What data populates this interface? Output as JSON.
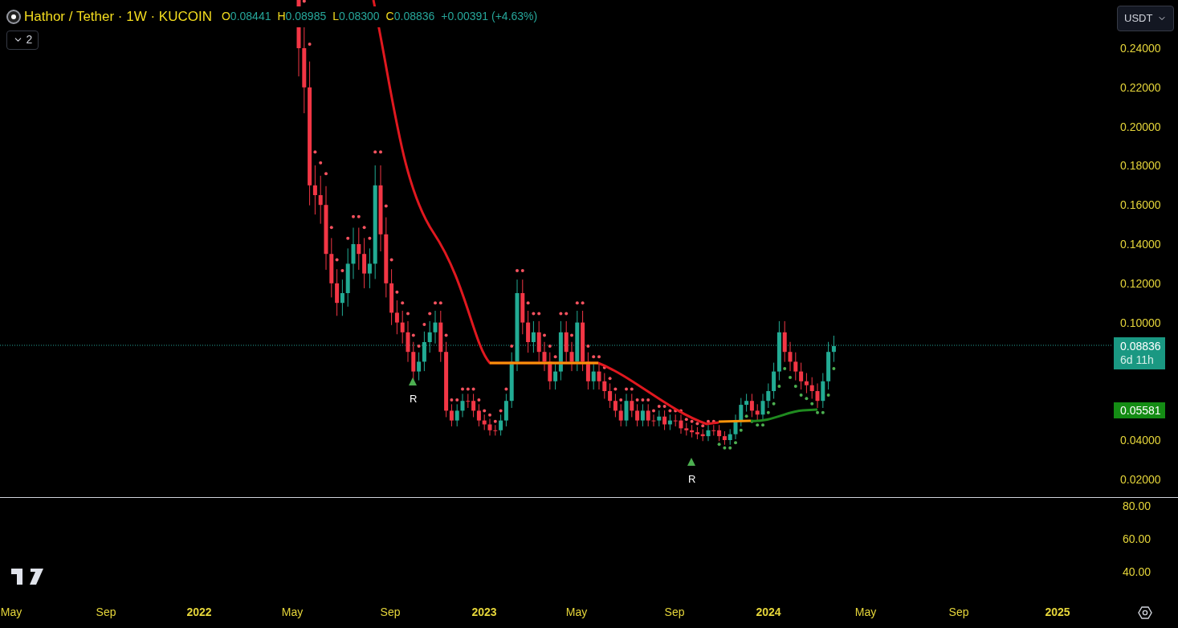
{
  "legend": {
    "symbol": "Hathor / Tether · 1W · KUCOIN",
    "ohlc": [
      {
        "key": "O",
        "value": "0.08441"
      },
      {
        "key": "H",
        "value": "0.08985"
      },
      {
        "key": "L",
        "value": "0.08300"
      },
      {
        "key": "C",
        "value": "0.08836"
      }
    ],
    "change": "+0.00391 (+4.63%)"
  },
  "indicators_toggle": {
    "count": "2"
  },
  "currency": "USDT",
  "price_axis": [
    "0.24000",
    "0.22000",
    "0.20000",
    "0.18000",
    "0.16000",
    "0.14000",
    "0.12000",
    "0.10000",
    "0.04000",
    "0.02000"
  ],
  "last_price": {
    "price": "0.08836",
    "countdown": "6d 11h"
  },
  "ma_label": "0.05581",
  "signals": [
    {
      "text": "R"
    },
    {
      "text": "R"
    }
  ],
  "lower_axis": [
    "80.00",
    "60.00",
    "40.00"
  ],
  "time_axis": [
    {
      "label": "May",
      "kind": "month"
    },
    {
      "label": "Sep",
      "kind": "month"
    },
    {
      "label": "2022",
      "kind": "year"
    },
    {
      "label": "May",
      "kind": "month"
    },
    {
      "label": "Sep",
      "kind": "month"
    },
    {
      "label": "2023",
      "kind": "year"
    },
    {
      "label": "May",
      "kind": "month"
    },
    {
      "label": "Sep",
      "kind": "month"
    },
    {
      "label": "2024",
      "kind": "year"
    },
    {
      "label": "May",
      "kind": "month"
    },
    {
      "label": "Sep",
      "kind": "month"
    },
    {
      "label": "2025",
      "kind": "year"
    }
  ]
}
